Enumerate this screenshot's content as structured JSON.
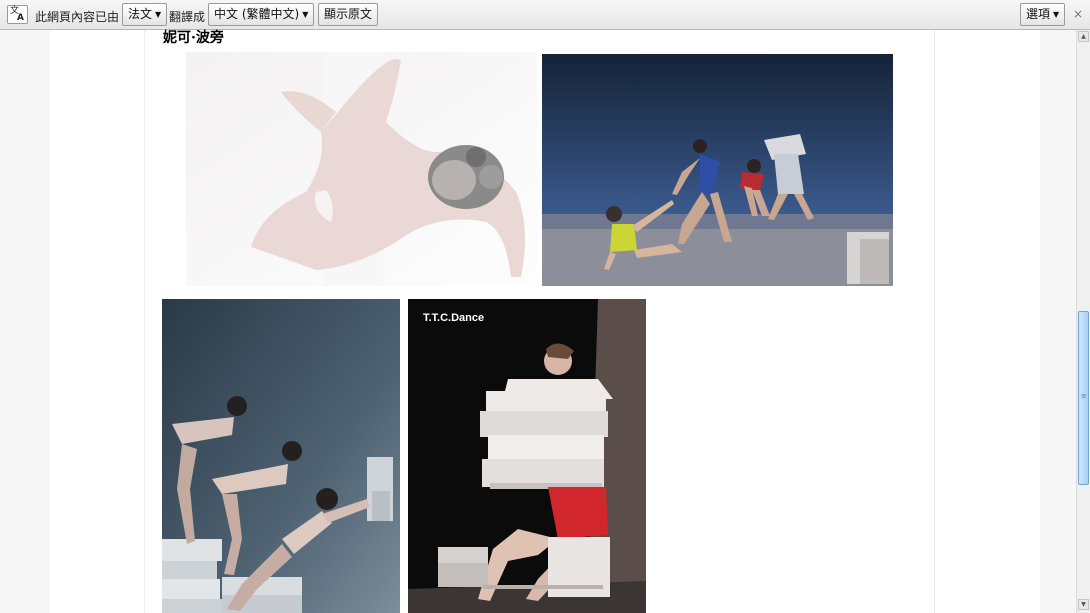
{
  "translate_bar": {
    "message": "此網頁內容已由",
    "from_language": "法文",
    "translated_to_label": "翻譯成",
    "to_language": "中文 (繁體中文)",
    "show_original_label": "顯示原文",
    "options_label": "選項",
    "close_glyph": "×",
    "icon": "translate-icon"
  },
  "article": {
    "heading": "妮可·波旁",
    "photo_caption": "T.T.C.Dance"
  },
  "scrollbar": {
    "up_arrow": "▲",
    "down_arrow": "▼",
    "thumb_grip": "≡"
  }
}
